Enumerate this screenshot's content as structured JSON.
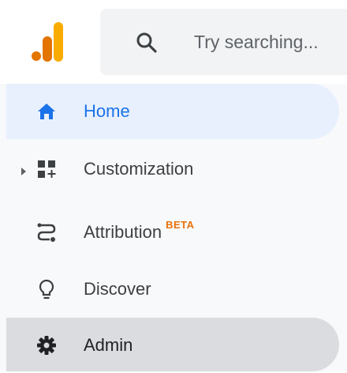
{
  "icons": {
    "logo": "analytics-logo",
    "search": "search-icon",
    "home": "home-icon",
    "customization": "dashboard-customize-icon",
    "attribution": "route-icon",
    "discover": "lightbulb-icon",
    "admin": "gear-icon",
    "expand": "triangle-right-icon"
  },
  "colors": {
    "logo_orange": "#f9ab00",
    "logo_dark_orange": "#e37400",
    "active_blue": "#1a73e8",
    "badge_orange": "#e8710a"
  },
  "search": {
    "placeholder": "Try searching..."
  },
  "nav": {
    "items": [
      {
        "label": "Home",
        "state": "active"
      },
      {
        "label": "Customization",
        "expandable": true
      },
      {
        "label": "Attribution",
        "badge": "BETA"
      },
      {
        "label": "Discover"
      },
      {
        "label": "Admin",
        "state": "selected"
      }
    ]
  }
}
